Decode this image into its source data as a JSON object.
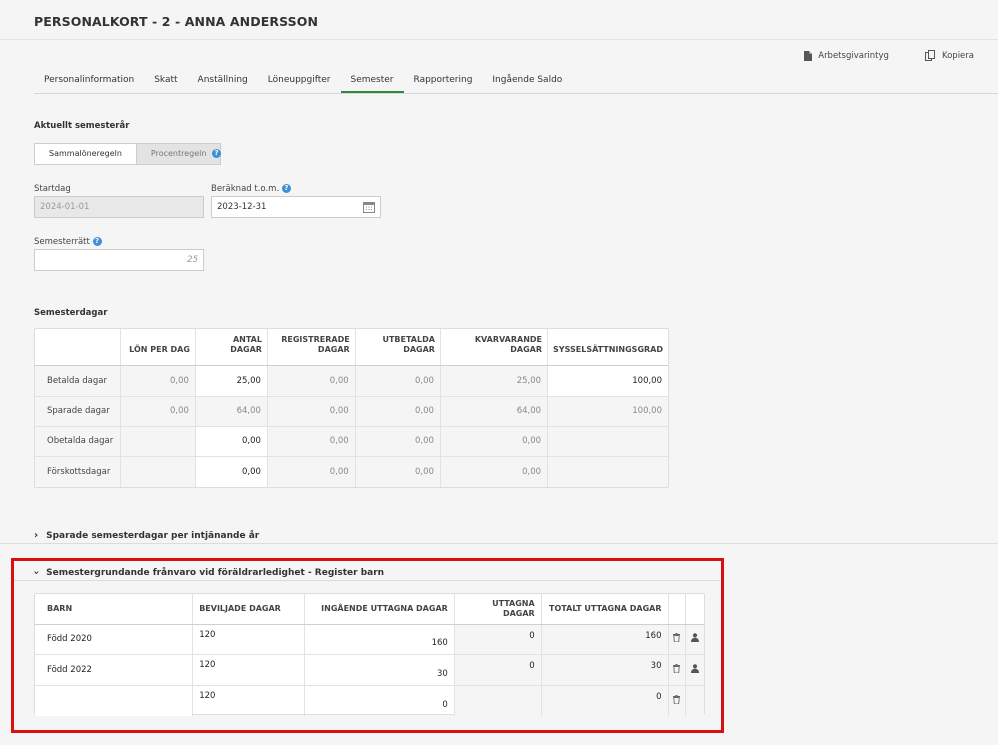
{
  "header": {
    "title": "PERSONALKORT - 2 - ANNA ANDERSSON"
  },
  "actions": [
    {
      "label": "Arbetsgivarintyg",
      "icon": "document-icon"
    },
    {
      "label": "Kopiera",
      "icon": "copy-icon"
    }
  ],
  "tabs": [
    {
      "label": "Personalinformation",
      "active": false
    },
    {
      "label": "Skatt",
      "active": false
    },
    {
      "label": "Anställning",
      "active": false
    },
    {
      "label": "Löneuppgifter",
      "active": false
    },
    {
      "label": "Semester",
      "active": true
    },
    {
      "label": "Rapportering",
      "active": false
    },
    {
      "label": "Ingående Saldo",
      "active": false
    }
  ],
  "semesterar": {
    "heading": "Aktuellt semesterår",
    "rules": [
      "Sammalöneregeln",
      "Procentregeln"
    ],
    "active_rule": "Sammalöneregeln",
    "startdag_label": "Startdag",
    "startdag_value": "2024-01-01",
    "beraknad_label": "Beräknad t.o.m.",
    "beraknad_value": "2023-12-31",
    "ratt_label": "Semesterrätt",
    "ratt_value": "25"
  },
  "semesterdagar": {
    "heading": "Semesterdagar",
    "columns": [
      "",
      "LÖN PER DAG",
      "ANTAL DAGAR",
      "REGISTRERADE DAGAR",
      "UTBETALDA DAGAR",
      "KVARVARANDE DAGAR",
      "SYSSELSÄTTNINGSGRAD"
    ],
    "rows": [
      {
        "label": "Betalda dagar",
        "lon": "0,00",
        "antal": "25,00",
        "reg": "0,00",
        "utb": "0,00",
        "kvar": "25,00",
        "syss": "100,00"
      },
      {
        "label": "Sparade dagar",
        "lon": "0,00",
        "antal": "64,00",
        "reg": "0,00",
        "utb": "0,00",
        "kvar": "64,00",
        "syss": "100,00"
      },
      {
        "label": "Obetalda dagar",
        "lon": "",
        "antal": "0,00",
        "reg": "0,00",
        "utb": "0,00",
        "kvar": "0,00",
        "syss": ""
      },
      {
        "label": "Förskottsdagar",
        "lon": "",
        "antal": "0,00",
        "reg": "0,00",
        "utb": "0,00",
        "kvar": "0,00",
        "syss": ""
      }
    ]
  },
  "sparade": {
    "heading": "Sparade semesterdagar per intjänande år"
  },
  "foraldra": {
    "heading": "Semestergrundande frånvaro vid föräldrarledighet - Register barn",
    "columns": [
      "BARN",
      "BEVILJADE DAGAR",
      "INGÅENDE UTTAGNA DAGAR",
      "UTTAGNA DAGAR",
      "TOTALT UTTAGNA DAGAR"
    ],
    "rows": [
      {
        "barn": "Född 2020",
        "beviljade": "120",
        "ingaende": "160",
        "uttagna": "0",
        "totalt": "160",
        "person": true
      },
      {
        "barn": "Född 2022",
        "beviljade": "120",
        "ingaende": "30",
        "uttagna": "0",
        "totalt": "30",
        "person": true
      },
      {
        "barn": "",
        "beviljade": "120",
        "ingaende": "0",
        "uttagna": "",
        "totalt": "0",
        "person": false
      }
    ]
  }
}
